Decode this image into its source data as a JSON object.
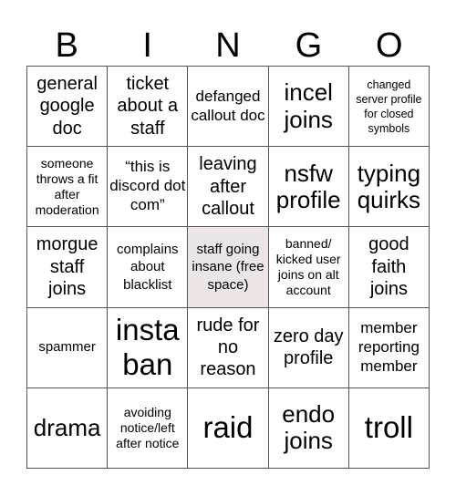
{
  "header": {
    "letters": [
      "B",
      "I",
      "N",
      "G",
      "O"
    ]
  },
  "free_space_color": "#ece6e6",
  "cells": [
    [
      {
        "text": "general google doc",
        "size": "m"
      },
      {
        "text": "ticket about a staff",
        "size": "m"
      },
      {
        "text": "defanged callout doc",
        "size": "ms"
      },
      {
        "text": "incel joins",
        "size": "l"
      },
      {
        "text": "changed server profile for closed symbols",
        "size": "xxs"
      }
    ],
    [
      {
        "text": "someone throws a fit after moderation",
        "size": "xs"
      },
      {
        "text": "“this is discord dot com”",
        "size": "ms"
      },
      {
        "text": "leaving after callout",
        "size": "m"
      },
      {
        "text": "nsfw profile",
        "size": "l"
      },
      {
        "text": "typing quirks",
        "size": "l"
      }
    ],
    [
      {
        "text": "morgue staff joins",
        "size": "m"
      },
      {
        "text": "complains about blacklist",
        "size": "s"
      },
      {
        "text": "staff going insane (free space)",
        "size": "s",
        "free": true
      },
      {
        "text": "banned/ kicked user joins on alt account",
        "size": "xs"
      },
      {
        "text": "good faith joins",
        "size": "m"
      }
    ],
    [
      {
        "text": "spammer",
        "size": "s"
      },
      {
        "text": "insta ban",
        "size": "xl"
      },
      {
        "text": "rude for no reason",
        "size": "m"
      },
      {
        "text": "zero day profile",
        "size": "m"
      },
      {
        "text": "member reporting member",
        "size": "ms"
      }
    ],
    [
      {
        "text": "drama",
        "size": "l"
      },
      {
        "text": "avoiding notice/left after notice",
        "size": "xs"
      },
      {
        "text": "raid",
        "size": "xl"
      },
      {
        "text": "endo joins",
        "size": "l"
      },
      {
        "text": "troll",
        "size": "xl"
      }
    ]
  ]
}
